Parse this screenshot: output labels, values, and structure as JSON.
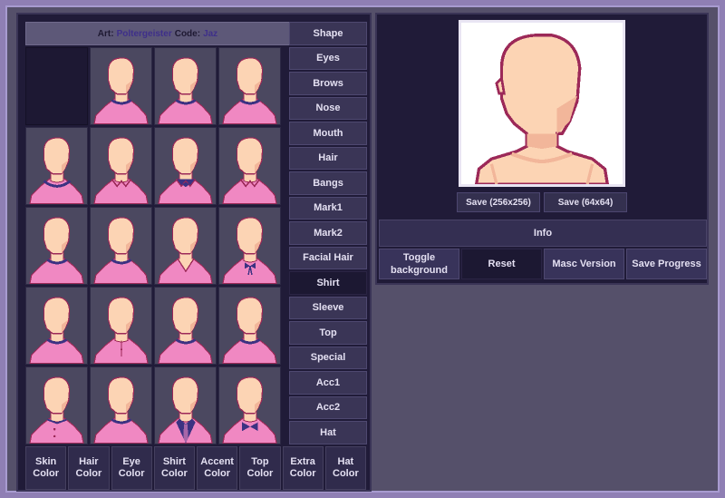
{
  "credit": {
    "art_label": "Art:",
    "art_name": "Poltergeister",
    "code_label": "Code:",
    "code_name": "Jaz"
  },
  "categories": [
    {
      "label": "Shape",
      "active": false
    },
    {
      "label": "Eyes",
      "active": false
    },
    {
      "label": "Brows",
      "active": false
    },
    {
      "label": "Nose",
      "active": false
    },
    {
      "label": "Mouth",
      "active": false
    },
    {
      "label": "Hair",
      "active": false
    },
    {
      "label": "Bangs",
      "active": false
    },
    {
      "label": "Mark1",
      "active": false
    },
    {
      "label": "Mark2",
      "active": false
    },
    {
      "label": "Facial Hair",
      "active": false
    },
    {
      "label": "Shirt",
      "active": true
    },
    {
      "label": "Sleeve",
      "active": false
    },
    {
      "label": "Top",
      "active": false
    },
    {
      "label": "Special",
      "active": false
    },
    {
      "label": "Acc1",
      "active": false
    },
    {
      "label": "Acc2",
      "active": false
    },
    {
      "label": "Hat",
      "active": false
    }
  ],
  "color_tabs": [
    {
      "line1": "Skin",
      "line2": "Color"
    },
    {
      "line1": "Hair",
      "line2": "Color"
    },
    {
      "line1": "Eye",
      "line2": "Color"
    },
    {
      "line1": "Shirt",
      "line2": "Color"
    },
    {
      "line1": "Accent",
      "line2": "Color"
    },
    {
      "line1": "Top",
      "line2": "Color"
    },
    {
      "line1": "Extra",
      "line2": "Color"
    },
    {
      "line1": "Hat",
      "line2": "Color"
    }
  ],
  "shirt_options": [
    "none",
    "crew",
    "crew",
    "crew",
    "scoop",
    "collar",
    "bowtie-collar",
    "collar",
    "crew",
    "crew",
    "v-neck",
    "bow",
    "crew",
    "placket",
    "crew",
    "crew",
    "buttons",
    "crew",
    "tie",
    "bowtie"
  ],
  "save_256_label": "Save (256x256)",
  "save_64_label": "Save (64x64)",
  "info_label": "Info",
  "actions": {
    "toggle_line1": "Toggle",
    "toggle_line2": "background",
    "reset": "Reset",
    "masc": "Masc Version",
    "save_progress": "Save Progress"
  },
  "colors": {
    "skin": "#fcd4b4",
    "skin_shadow": "#f2b69a",
    "outline": "#9c2958",
    "shirt": "#f088c2",
    "accent": "#3c3282",
    "active_tab": "#1c1832"
  }
}
